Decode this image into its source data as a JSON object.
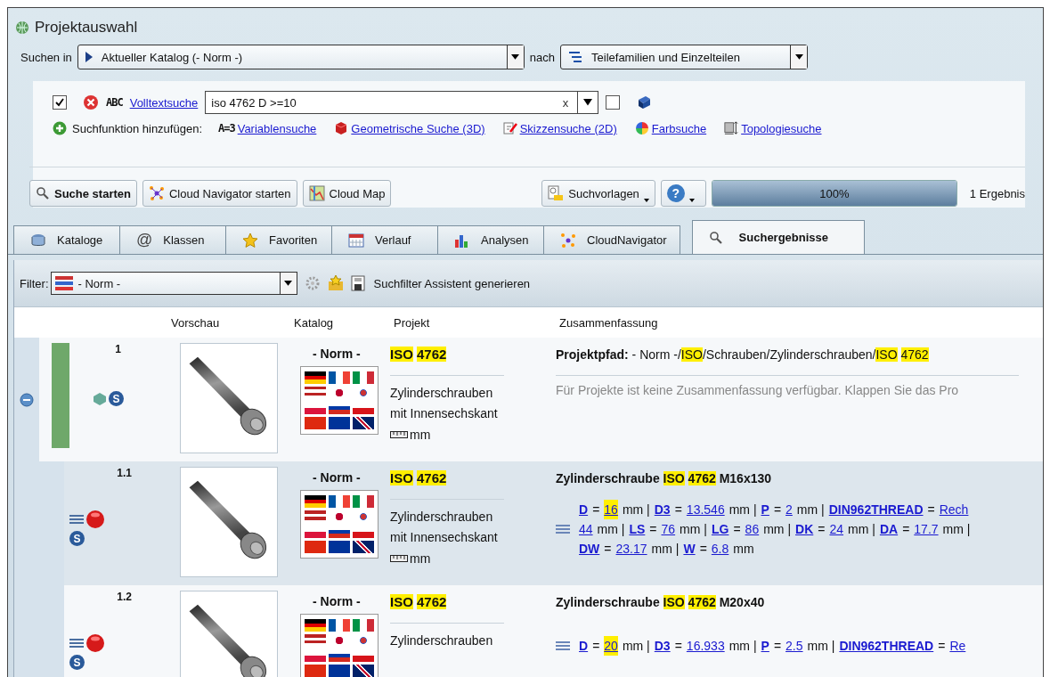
{
  "window": {
    "title": "Projektauswahl"
  },
  "search_in": {
    "label": "Suchen in",
    "value": "Aktueller Katalog (- Norm -)",
    "after_label": "nach",
    "target": "Teilefamilien und Einzelteilen"
  },
  "fulltext": {
    "checked": true,
    "abc": "ABC",
    "link": "Volltextsuche",
    "value": "iso 4762 D >=10",
    "clear": "x",
    "extra_checked": false
  },
  "add_functions": {
    "label": "Suchfunktion hinzufügen:",
    "items": [
      {
        "kind": "variable",
        "prefix": "A=3",
        "label": "Variablensuche"
      },
      {
        "kind": "geometric",
        "label": "Geometrische Suche (3D)"
      },
      {
        "kind": "sketch",
        "label": "Skizzensuche (2D)"
      },
      {
        "kind": "color",
        "label": "Farbsuche"
      },
      {
        "kind": "topology",
        "label": "Topologiesuche"
      }
    ]
  },
  "toolbar": {
    "buttons": [
      {
        "kind": "search",
        "label": "Suche starten"
      },
      {
        "kind": "cloud",
        "label": "Cloud Navigator starten"
      },
      {
        "kind": "map",
        "label": "Cloud Map"
      }
    ],
    "templates": "Suchvorlagen",
    "help": "?",
    "progress": {
      "level": 1,
      "label": "100%"
    },
    "result_count": "1 Ergebnis"
  },
  "tabs": [
    {
      "kind": "catalogs",
      "label": "Kataloge",
      "selected": false
    },
    {
      "kind": "classes",
      "symbol": "@",
      "label": "Klassen",
      "selected": false
    },
    {
      "kind": "favorites",
      "label": "Favoriten",
      "selected": false
    },
    {
      "kind": "history",
      "label": "Verlauf",
      "selected": false
    },
    {
      "kind": "analysis",
      "label": "Analysen",
      "selected": false
    },
    {
      "kind": "cloud",
      "label": "CloudNavigator",
      "selected": false
    },
    {
      "kind": "search",
      "label": "Suchergebnisse",
      "selected": true
    }
  ],
  "filter": {
    "label": "Filter:",
    "value": "- Norm -",
    "assistant": "Suchfilter Assistent generieren"
  },
  "columns": [
    "Vorschau",
    "Katalog",
    "Projekt",
    "Zusammenfassung"
  ],
  "rows": [
    {
      "kind": "project",
      "number": "1",
      "expanded": true,
      "type_badge": "S",
      "catalog": "- Norm -",
      "description": [
        "Zylinderschrauben",
        "mit Innensechskant"
      ],
      "unit": "mm",
      "project": {
        "text": "ISO 4762",
        "hl": true
      },
      "title": [
        {
          "text": "Projektpfad:",
          "bold": true
        },
        {
          "text": " - Norm -/"
        },
        {
          "text": "ISO",
          "hl": true
        },
        {
          "text": "/Schrauben/Zylinderschrauben/"
        },
        {
          "text": "ISO 4762",
          "hl": true
        }
      ],
      "note": "Für Projekte ist keine Zusammenfassung verfügbar. Klappen Sie das Pro"
    },
    {
      "kind": "part",
      "number": "1.1",
      "badge": "S",
      "catalog": "- Norm -",
      "description": [
        "Zylinderschrauben",
        "mit Innensechskant"
      ],
      "unit": "mm",
      "project": {
        "text": "ISO 4762",
        "hl": true
      },
      "title": [
        {
          "text": "Zylinderschraube "
        },
        {
          "text": "ISO 4762",
          "hl": true
        },
        {
          "text": " M16x130"
        }
      ],
      "lines": [
        [
          {
            "kind": "param",
            "text": "D"
          },
          {
            "kind": "text",
            "text": "="
          },
          {
            "kind": "value",
            "text": "16",
            "hl": true
          },
          {
            "kind": "text",
            "text": "mm |"
          },
          {
            "kind": "param",
            "text": "D3"
          },
          {
            "kind": "text",
            "text": "="
          },
          {
            "kind": "value",
            "text": "13.546"
          },
          {
            "kind": "text",
            "text": "mm |"
          },
          {
            "kind": "param",
            "text": "P"
          },
          {
            "kind": "text",
            "text": "="
          },
          {
            "kind": "value",
            "text": "2"
          },
          {
            "kind": "text",
            "text": "mm |"
          },
          {
            "kind": "param",
            "text": "DIN962THREAD"
          },
          {
            "kind": "text",
            "text": "="
          },
          {
            "kind": "value",
            "text": "Rech"
          }
        ],
        [
          {
            "kind": "value",
            "text": "44"
          },
          {
            "kind": "text",
            "text": "mm |"
          },
          {
            "kind": "param",
            "text": "LS"
          },
          {
            "kind": "text",
            "text": "="
          },
          {
            "kind": "value",
            "text": "76"
          },
          {
            "kind": "text",
            "text": "mm |"
          },
          {
            "kind": "param",
            "text": "LG"
          },
          {
            "kind": "text",
            "text": "="
          },
          {
            "kind": "value",
            "text": "86"
          },
          {
            "kind": "text",
            "text": "mm |"
          },
          {
            "kind": "param",
            "text": "DK"
          },
          {
            "kind": "text",
            "text": "="
          },
          {
            "kind": "value",
            "text": "24"
          },
          {
            "kind": "text",
            "text": "mm |"
          },
          {
            "kind": "param",
            "text": "DA"
          },
          {
            "kind": "text",
            "text": "="
          },
          {
            "kind": "value",
            "text": "17.7"
          },
          {
            "kind": "text",
            "text": "mm |"
          }
        ],
        [
          {
            "kind": "param",
            "text": "DW"
          },
          {
            "kind": "text",
            "text": "="
          },
          {
            "kind": "value",
            "text": "23.17"
          },
          {
            "kind": "text",
            "text": "mm |"
          },
          {
            "kind": "param",
            "text": "W"
          },
          {
            "kind": "text",
            "text": "="
          },
          {
            "kind": "value",
            "text": "6.8"
          },
          {
            "kind": "text",
            "text": "mm"
          }
        ]
      ]
    },
    {
      "kind": "part",
      "number": "1.2",
      "badge": "S",
      "catalog": "- Norm -",
      "description": [
        "Zylinderschrauben"
      ],
      "project": {
        "text": "ISO 4762",
        "hl": true
      },
      "title": [
        {
          "text": "Zylinderschraube "
        },
        {
          "text": "ISO 4762",
          "hl": true
        },
        {
          "text": " M20x40"
        }
      ],
      "lines": [
        [
          {
            "kind": "param",
            "text": "D"
          },
          {
            "kind": "text",
            "text": "="
          },
          {
            "kind": "value",
            "text": "20",
            "hl": true
          },
          {
            "kind": "text",
            "text": "mm |"
          },
          {
            "kind": "param",
            "text": "D3"
          },
          {
            "kind": "text",
            "text": "="
          },
          {
            "kind": "value",
            "text": "16.933"
          },
          {
            "kind": "text",
            "text": "mm |"
          },
          {
            "kind": "param",
            "text": "P"
          },
          {
            "kind": "text",
            "text": "="
          },
          {
            "kind": "value",
            "text": "2.5"
          },
          {
            "kind": "text",
            "text": "mm |"
          },
          {
            "kind": "param",
            "text": "DIN962THREAD"
          },
          {
            "kind": "text",
            "text": "="
          },
          {
            "kind": "value",
            "text": "Re"
          }
        ]
      ]
    }
  ]
}
